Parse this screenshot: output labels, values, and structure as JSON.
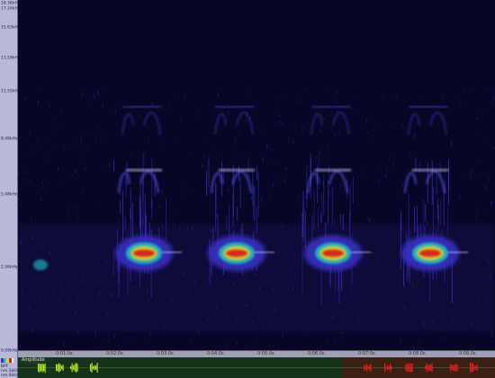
{
  "y_axis": {
    "labels": [
      "18.36kHz",
      "17.24kHz",
      "15.63kHz",
      "13.18kHz",
      "11.55kHz",
      "8.48kHz",
      "5.48kHz",
      "2.56kHz",
      "0.09kHz"
    ]
  },
  "time_axis": {
    "labels": [
      "0:01.0s",
      "0:02.0s",
      "0:03.0s",
      "0:04.0s",
      "0:05.0s",
      "0:06.0s",
      "0:07.0s",
      "0:08.0s",
      "0:09.0s"
    ]
  },
  "legend": {
    "line1": "BPF",
    "line2": "nm.1kHz",
    "line3": "nm.4kHz"
  },
  "waveform": {
    "label": "Amplitude"
  },
  "colors": {
    "background": "#080626",
    "low": "#3a32c8",
    "mid": "#e6d21e",
    "high": "#dc1e1e",
    "wave": "#b4e61e",
    "wave_selected": "#dc1e1e"
  }
}
